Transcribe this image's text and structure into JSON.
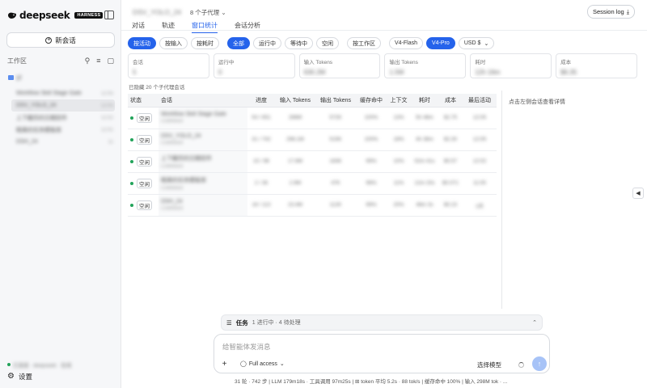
{
  "sidebar": {
    "logo_text": "deepseek",
    "logo_badge": "HARNESS",
    "new_chat_label": "新会话",
    "workspace_label": "工作区",
    "folder_name": "gt",
    "sessions": [
      {
        "name": "Workflow Skill Stage Gate",
        "time": "12:05"
      },
      {
        "name": "DSV_YOLO_24",
        "time": "12:05"
      },
      {
        "name": "上下翻页的日期控件",
        "time": "12:02"
      },
      {
        "name": "精美的任务模板库",
        "time": "12:01"
      },
      {
        "name": "DSH_24",
        "time": "11"
      }
    ],
    "status_text": "已连接 · deepseek · 在线",
    "settings_label": "设置"
  },
  "header": {
    "title": "DSV_YOLO_24",
    "agents_label": "8 个子代理",
    "tabs": [
      "对话",
      "轨迹",
      "窗口统计",
      "会话分析"
    ],
    "active_tab": 2,
    "session_log_label": "Session log"
  },
  "filters": {
    "chips": [
      "按活动",
      "按输入",
      "按耗时",
      "全部",
      "运行中",
      "等待中",
      "空闲",
      "按工作区",
      "V4-Flash",
      "V4-Pro"
    ],
    "currency": "USD $"
  },
  "cards": [
    {
      "label": "会话",
      "value": "5"
    },
    {
      "label": "运行中",
      "value": "0"
    },
    {
      "label": "输入 Tokens",
      "value": "630.2M"
    },
    {
      "label": "输出 Tokens",
      "value": "1.5M"
    },
    {
      "label": "耗时",
      "value": "12h 16m"
    },
    {
      "label": "成本",
      "value": "$6.35"
    }
  ],
  "hidden_note": "已隐藏 20 个子代理会话",
  "table": {
    "headers": [
      "状态",
      "会话",
      "进度",
      "输入 Tokens",
      "输出 Tokens",
      "缓存命中",
      "上下文",
      "耗时",
      "成本",
      "最后活动"
    ],
    "rows": [
      {
        "state": "空闲",
        "name": "Workflow Skill Stage Gate",
        "sub": "Codebase",
        "progress": "54 / 651",
        "input": "288M",
        "output": "572K",
        "cache": "100%",
        "context": "13%",
        "time": "5h 48m",
        "cost": "$2.75",
        "last": "12:05"
      },
      {
        "state": "空闲",
        "name": "DSV_YOLO_24",
        "sub": "Codebase",
        "progress": "31 / 742",
        "input": "298.1M",
        "output": "515K",
        "cache": "100%",
        "context": "18%",
        "time": "4h 36m",
        "cost": "$2.30",
        "last": "12:05"
      },
      {
        "state": "空闲",
        "name": "上下翻页的日期控件",
        "sub": "Codebase",
        "progress": "15 / 98",
        "input": "17.8M",
        "output": "183K",
        "cache": "99%",
        "context": "10%",
        "time": "52m 41s",
        "cost": "$0.57",
        "last": "12:02"
      },
      {
        "state": "空闲",
        "name": "精美的任务模板库",
        "sub": "Codebase",
        "progress": "2 / 36",
        "input": "2.9M",
        "output": "47K",
        "cache": "98%",
        "context": "11%",
        "time": "12m 20s",
        "cost": "$0.071",
        "last": "11:05"
      },
      {
        "state": "空闲",
        "name": "DSH_24",
        "sub": "Codebase",
        "progress": "18 / 113",
        "input": "23.4M",
        "output": "112K",
        "cache": "99%",
        "context": "20%",
        "time": "46m 3s",
        "cost": "$0.23",
        "last": "1天"
      }
    ]
  },
  "detail_hint": "点击左侧会话查看详情",
  "taskbar": {
    "title": "任务",
    "status": "1 进行中 · 4 待处理"
  },
  "composer": {
    "placeholder": "给智能体发消息",
    "access_label": "Full access",
    "model_label": "选择模型"
  },
  "footer": "31 轮 · 742 步  |  LLM 179m18s · 工具调用 97m25s  |  ⊞ token 平均 5.2s · 88 tok/s  |  缓存命中 100%  |  输入 298M tok · ..."
}
